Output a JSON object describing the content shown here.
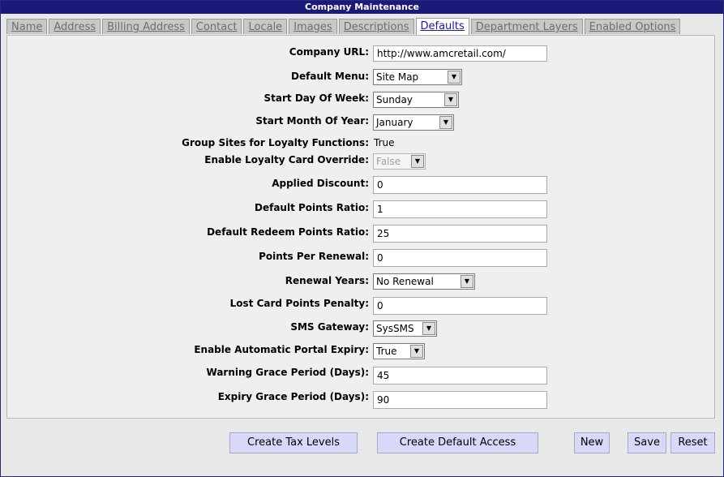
{
  "window": {
    "title": "Company Maintenance"
  },
  "tabs": [
    {
      "label": "Name"
    },
    {
      "label": "Address"
    },
    {
      "label": "Billing Address"
    },
    {
      "label": "Contact"
    },
    {
      "label": "Locale"
    },
    {
      "label": "Images"
    },
    {
      "label": "Descriptions"
    },
    {
      "label": "Defaults",
      "active": true
    },
    {
      "label": "Department Layers"
    },
    {
      "label": "Enabled Options"
    }
  ],
  "form": {
    "company_url": {
      "label": "Company URL:",
      "value": "http://www.amcretail.com/"
    },
    "default_menu": {
      "label": "Default Menu:",
      "value": "Site Map"
    },
    "start_day": {
      "label": "Start Day Of Week:",
      "value": "Sunday"
    },
    "start_month": {
      "label": "Start Month Of Year:",
      "value": "January"
    },
    "group_sites": {
      "label": "Group Sites for Loyalty Functions:",
      "value": "True"
    },
    "loyalty_override": {
      "label": "Enable Loyalty Card Override:",
      "value": "False"
    },
    "applied_discount": {
      "label": "Applied Discount:",
      "value": "0"
    },
    "points_ratio": {
      "label": "Default Points Ratio:",
      "value": "1"
    },
    "redeem_ratio": {
      "label": "Default Redeem Points Ratio:",
      "value": "25"
    },
    "points_renewal": {
      "label": "Points Per Renewal:",
      "value": "0"
    },
    "renewal_years": {
      "label": "Renewal Years:",
      "value": "No Renewal"
    },
    "lost_card_penalty": {
      "label": "Lost Card Points Penalty:",
      "value": "0"
    },
    "sms_gateway": {
      "label": "SMS Gateway:",
      "value": "SysSMS"
    },
    "portal_expiry": {
      "label": "Enable Automatic Portal Expiry:",
      "value": "True"
    },
    "warning_grace": {
      "label": "Warning Grace Period (Days):",
      "value": "45"
    },
    "expiry_grace": {
      "label": "Expiry Grace Period (Days):",
      "value": "90"
    }
  },
  "buttons": {
    "create_tax_levels": "Create Tax Levels",
    "create_default_access": "Create Default Access",
    "new": "New",
    "save": "Save",
    "reset": "Reset"
  },
  "icons": {
    "dropdown": "chevron-down-icon"
  }
}
